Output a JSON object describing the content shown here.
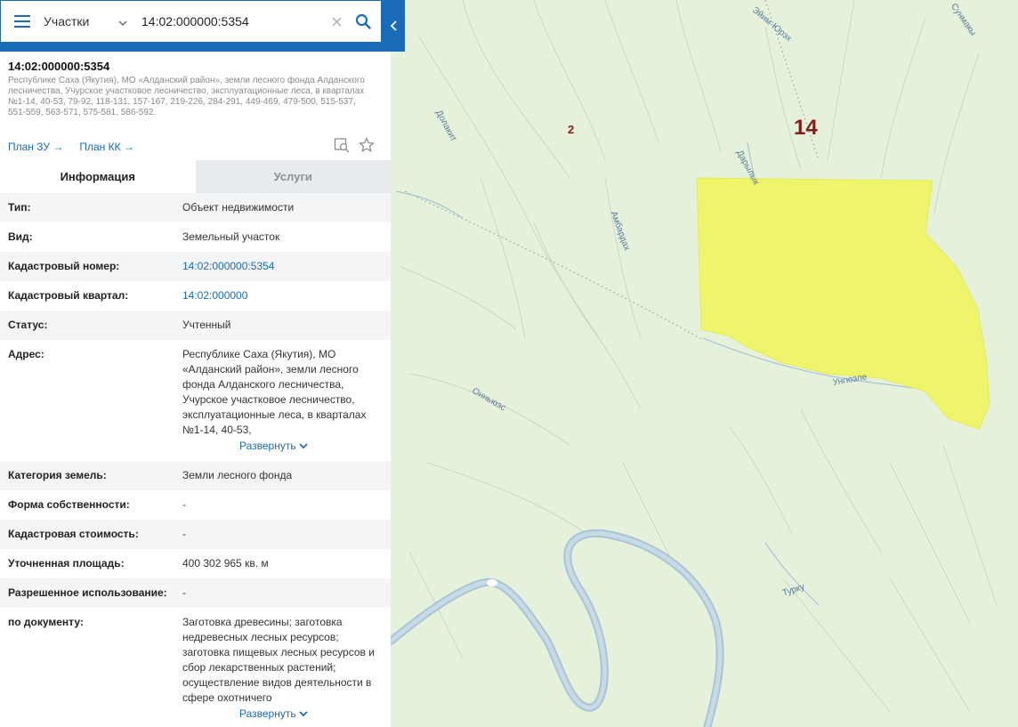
{
  "search": {
    "layer": "Участки",
    "query": "14:02:000000:5354"
  },
  "object": {
    "title": "14:02:000000:5354",
    "description": "Республике Саха (Якутия), МО «Алданский район», земли лесного фонда Алданского лесничества, Учурское участковое лесничество, эксплуатационные леса, в кварталах №1-14, 40-53, 79-92, 118-131, 157-167, 219-226, 284-291, 449-469, 479-500, 515-537, 551-559, 563-571, 575-581, 586-592."
  },
  "plans": {
    "zu": "План ЗУ →",
    "kk": "План КК →"
  },
  "tabs": {
    "info": "Информация",
    "services": "Услуги"
  },
  "rows": [
    {
      "key": "Тип:",
      "value": "Объект недвижимости"
    },
    {
      "key": "Вид:",
      "value": "Земельный участок"
    },
    {
      "key": "Кадастровый номер:",
      "value": "14:02:000000:5354"
    },
    {
      "key": "Кадастровый квартал:",
      "value": "14:02:000000"
    },
    {
      "key": "Статус:",
      "value": "Учтенный"
    },
    {
      "key": "Адрес:",
      "value": "Республике Саха (Якутия), МО «Алданский район», земли лесного фонда Алданского лесничества, Учурское участковое лесничество, эксплуатационные леса, в кварталах №1-14, 40-53,"
    },
    {
      "key": "Категория земель:",
      "value": "Земли лесного фонда"
    },
    {
      "key": "Форма собственности:",
      "value": "-"
    },
    {
      "key": "Кадастровая стоимость:",
      "value": "-"
    },
    {
      "key": "Уточненная площадь:",
      "value": "400 302 965 кв. м"
    },
    {
      "key": "Разрешенное использование:",
      "value": "-"
    },
    {
      "key": "по документу:",
      "value": "Заготовка древесины; заготовка недревесных лесных ресурсов; заготовка пищевых лесных ресурсов и сбор лекарственных растений; осуществление видов деятельности в сфере охотничего"
    }
  ],
  "expand_label": "Развернуть",
  "map": {
    "quarter_big": "14",
    "quarter_small": "2",
    "rivers": [
      "Эйим-Юрэх",
      "Сунмакы",
      "Долакит",
      "Дарылык",
      "Амбардах",
      "Онньюэс",
      "Унгюэле",
      "Турку"
    ],
    "parcel_color": "#eef56a",
    "land_color": "#e6f1dc",
    "river_color": "#a9c4d6"
  },
  "colors": {
    "accent": "#1a6bb8"
  }
}
